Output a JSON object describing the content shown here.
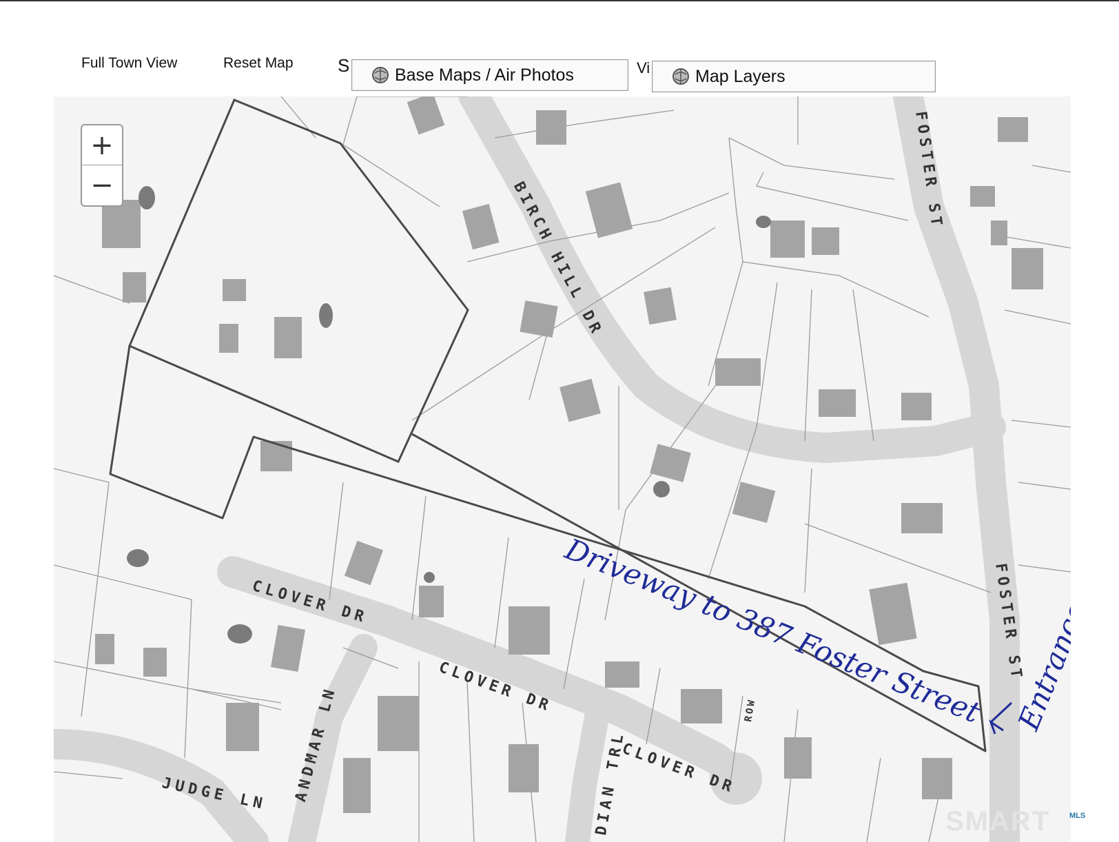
{
  "toolbar": {
    "full_town_view": "Full Town View",
    "reset_map": "Reset Map",
    "partial_s": "S",
    "partial_vi": "Vi",
    "base_maps": "Base Maps / Air Photos",
    "map_layers": "Map Layers"
  },
  "zoom": {
    "in": "+",
    "out": "−"
  },
  "streets": {
    "birch_hill": "BIRCH HILL DR",
    "foster_upper": "FOSTER ST",
    "foster_lower": "FOSTER ST",
    "clover_1": "CLOVER DR",
    "clover_2": "CLOVER DR",
    "clover_3": "CLOVER DR",
    "andmar": "ANDMAR LN",
    "judge": "JUDGE LN",
    "indian": "DIAN TRL",
    "row": "ROW"
  },
  "annotations": {
    "driveway": "Driveway to 387 Foster Street",
    "entrance": "Entrance"
  },
  "brand": {
    "name": "SMART",
    "sub": "MLS"
  },
  "colors": {
    "highlight_line": "#444444",
    "annotation_ink": "#1f2b98",
    "road": "#d8d8d8",
    "building": "#9c9c9c"
  }
}
